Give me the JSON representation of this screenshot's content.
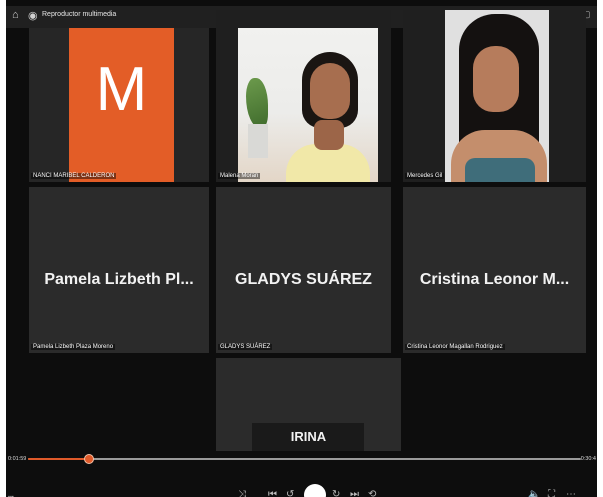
{
  "window": {
    "title": "Reproductor multimedia",
    "minimize": "–",
    "maximize": "▢",
    "close": "✕"
  },
  "tiles": [
    {
      "caption": "NANCI MARIBEL CALDERON",
      "avatar_letter": "M"
    },
    {
      "caption": "Malena Moran"
    },
    {
      "caption": "Mercedes Gil"
    },
    {
      "display_name": "Pamela Lizbeth Pl...",
      "caption": "Pamela Lizbeth Plaza Moreno"
    },
    {
      "display_name": "GLADYS SUÁREZ",
      "caption": "GLADYS SUÁREZ"
    },
    {
      "display_name": "Cristina Leonor M...",
      "caption": "Cristina Leonor Magallan Rodriguez"
    },
    {
      "display_name": "IRINA"
    }
  ],
  "player": {
    "current_time": "0:01:59",
    "total_time": "0:30:4",
    "progress": 0.11,
    "media_title": "...",
    "colors": {
      "accent": "#e05a2a",
      "avatar_bg": "#e35d27"
    }
  }
}
